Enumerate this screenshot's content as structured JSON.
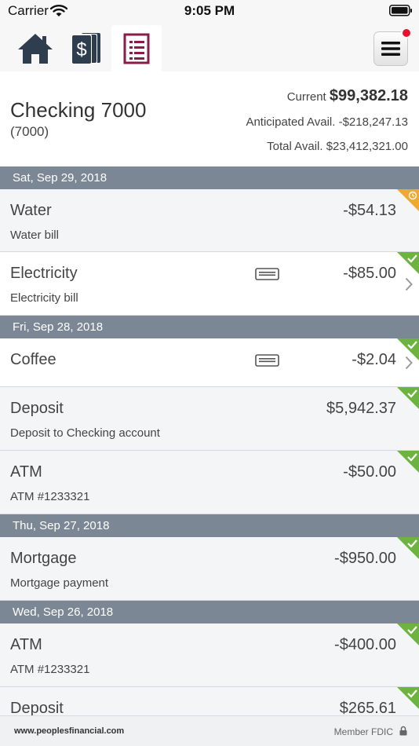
{
  "status_bar": {
    "carrier": "Carrier",
    "time": "9:05 PM"
  },
  "tabs": [
    {
      "icon": "home-icon",
      "active": false
    },
    {
      "icon": "money-icon",
      "active": false
    },
    {
      "icon": "register-icon",
      "active": true
    }
  ],
  "account": {
    "name": "Checking 7000",
    "number": "(7000)",
    "current_label": "Current",
    "current_amount": "$99,382.18",
    "anticipated_label": "Anticipated Avail.",
    "anticipated_amount": "-$218,247.13",
    "total_label": "Total Avail.",
    "total_amount": "$23,412,321.00"
  },
  "groups": [
    {
      "date": "Sat, Sep 29, 2018",
      "transactions": [
        {
          "name": "Water",
          "memo": "Water bill",
          "amount": "-$54.13",
          "status": "pending",
          "card": false,
          "chevron": false
        },
        {
          "name": "Electricity",
          "memo": "Electricity bill",
          "amount": "-$85.00",
          "status": "cleared",
          "card": true,
          "chevron": true
        }
      ]
    },
    {
      "date": "Fri, Sep 28, 2018",
      "transactions": [
        {
          "name": "Coffee",
          "memo": "",
          "amount": "-$2.04",
          "status": "cleared",
          "card": true,
          "chevron": true
        },
        {
          "name": "Deposit",
          "memo": "Deposit to Checking account",
          "amount": "$5,942.37",
          "status": "cleared",
          "card": false,
          "chevron": false
        },
        {
          "name": "ATM",
          "memo": "ATM #1233321",
          "amount": "-$50.00",
          "status": "cleared",
          "card": false,
          "chevron": false
        }
      ]
    },
    {
      "date": "Thu, Sep 27, 2018",
      "transactions": [
        {
          "name": "Mortgage",
          "memo": "Mortgage payment",
          "amount": "-$950.00",
          "status": "cleared",
          "card": false,
          "chevron": false
        }
      ]
    },
    {
      "date": "Wed, Sep 26, 2018",
      "transactions": [
        {
          "name": "ATM",
          "memo": "ATM #1233321",
          "amount": "-$400.00",
          "status": "cleared",
          "card": false,
          "chevron": false
        },
        {
          "name": "Deposit",
          "memo": "",
          "amount": "$265.61",
          "status": "cleared",
          "card": false,
          "chevron": false
        }
      ]
    }
  ],
  "footer": {
    "site": "www.peoplesfinancial.com",
    "fdic": "Member FDIC"
  },
  "colors": {
    "cleared": "#6db33f",
    "pending": "#f0a830",
    "date_header": "#7c8795",
    "register_tab": "#8a1c4a",
    "icon_dark": "#2f3e4e"
  }
}
